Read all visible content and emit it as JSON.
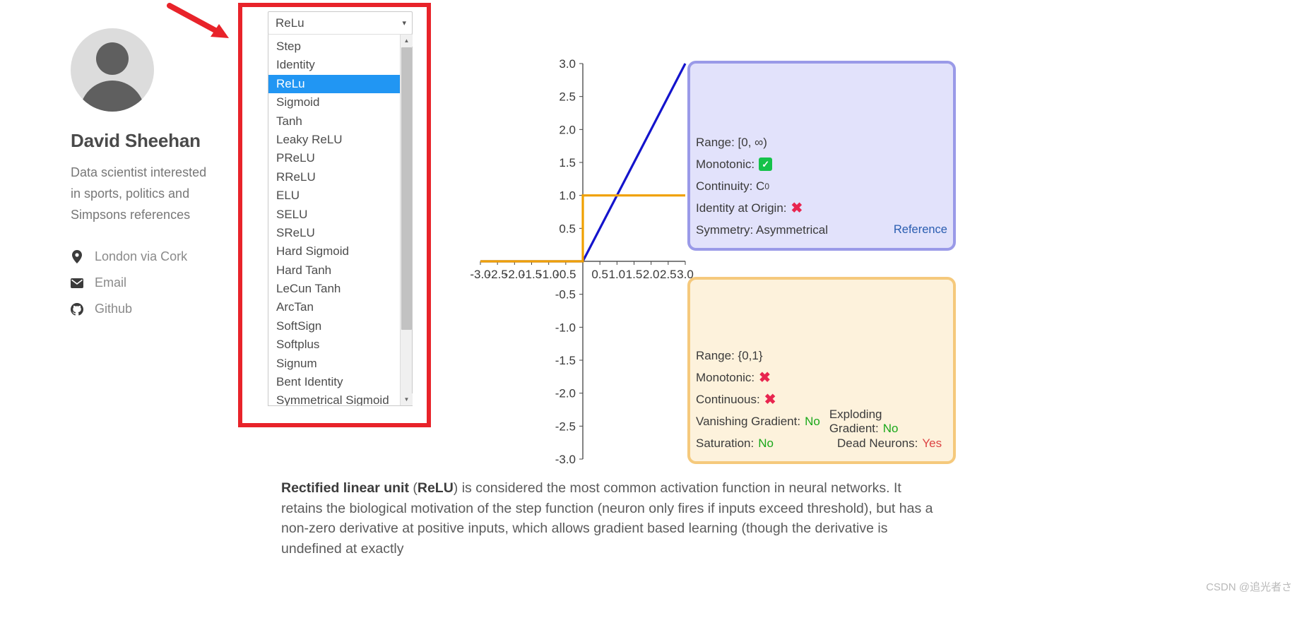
{
  "profile": {
    "name": "David Sheehan",
    "bio": "Data scientist interested in sports, politics and Simpsons references",
    "links": [
      {
        "icon": "location-pin-icon",
        "label": "London via Cork"
      },
      {
        "icon": "envelope-icon",
        "label": "Email"
      },
      {
        "icon": "github-icon",
        "label": "Github"
      }
    ]
  },
  "selector": {
    "selected": "ReLu",
    "chevron": "▾",
    "options": [
      "Step",
      "Identity",
      "ReLu",
      "Sigmoid",
      "Tanh",
      "Leaky ReLU",
      "PReLU",
      "RReLU",
      "ELU",
      "SELU",
      "SReLU",
      "Hard Sigmoid",
      "Hard Tanh",
      "LeCun Tanh",
      "ArcTan",
      "SoftSign",
      "Softplus",
      "Signum",
      "Bent Identity",
      "Symmetrical Sigmoid"
    ],
    "highlighted": "ReLu",
    "scroll_up_glyph": "▲",
    "scroll_down_glyph": "▼"
  },
  "chart_data": {
    "type": "line",
    "title": "",
    "xlabel": "",
    "ylabel": "",
    "xlim": [
      -3.0,
      3.0
    ],
    "ylim": [
      -3.0,
      3.0
    ],
    "xticks": [
      "-3.0",
      "-2.5",
      "-2.0",
      "-1.5",
      "-1.0",
      "-0.5",
      "0.5",
      "1.0",
      "1.5",
      "2.0",
      "2.5",
      "3.0"
    ],
    "yticks": [
      "3.0",
      "2.5",
      "2.0",
      "1.5",
      "1.0",
      "0.5",
      "-0.5",
      "-1.0",
      "-1.5",
      "-2.0",
      "-2.5",
      "-3.0"
    ],
    "grid": false,
    "legend": "none",
    "series": [
      {
        "name": "ReLu",
        "color": "#1414cc",
        "x": [
          -3.0,
          0.0,
          3.0
        ],
        "values": [
          0.0,
          0.0,
          3.0
        ]
      },
      {
        "name": "Step",
        "color": "#f0a000",
        "x": [
          -3.0,
          0.0,
          0.0,
          3.0
        ],
        "values": [
          0.0,
          0.0,
          1.0,
          1.0
        ]
      }
    ]
  },
  "card_primary": {
    "color": "#e2e2fb",
    "border": "#9a9ae8",
    "rows": [
      {
        "label": "Range: [0, ∞)",
        "mark": ""
      },
      {
        "label": "Monotonic:",
        "mark": "tick"
      },
      {
        "label": "Continuity: C",
        "sup": "0",
        "mark": ""
      },
      {
        "label": "Identity at Origin:",
        "mark": "cross"
      },
      {
        "label": "Symmetry: Asymmetrical",
        "mark": "",
        "link": "Reference"
      }
    ]
  },
  "card_secondary": {
    "color": "#fdf2dc",
    "border": "#f5c97c",
    "rows": [
      {
        "label": "Range: {0,1}",
        "mark": ""
      },
      {
        "label": "Monotonic:",
        "mark": "cross"
      },
      {
        "label": "Continuous:",
        "mark": "cross"
      }
    ],
    "grid_rows": [
      {
        "left_label": "Vanishing Gradient:",
        "left_value": "No",
        "left_state": "no",
        "right_label": "Exploding Gradient:",
        "right_value": "No",
        "right_state": "no"
      },
      {
        "left_label": "Saturation:",
        "left_value": "No",
        "left_state": "no",
        "right_label": "Dead Neurons:",
        "right_value": "Yes",
        "right_state": "yes"
      }
    ]
  },
  "description": {
    "bold_lead": "Rectified linear unit",
    "paren_open": " (",
    "bold_abbr": "ReLU",
    "rest": ") is considered the most common activation function in neural networks. It retains the biological motivation of the step function (neuron only fires if inputs exceed threshold), but has a non-zero derivative at positive inputs, which allows gradient based learning (though the derivative is undefined at exactly"
  },
  "watermark": "CSDN @追光者さ",
  "annotation": {
    "highlight_color": "#e8232a",
    "arrow_color": "#e8232a"
  }
}
